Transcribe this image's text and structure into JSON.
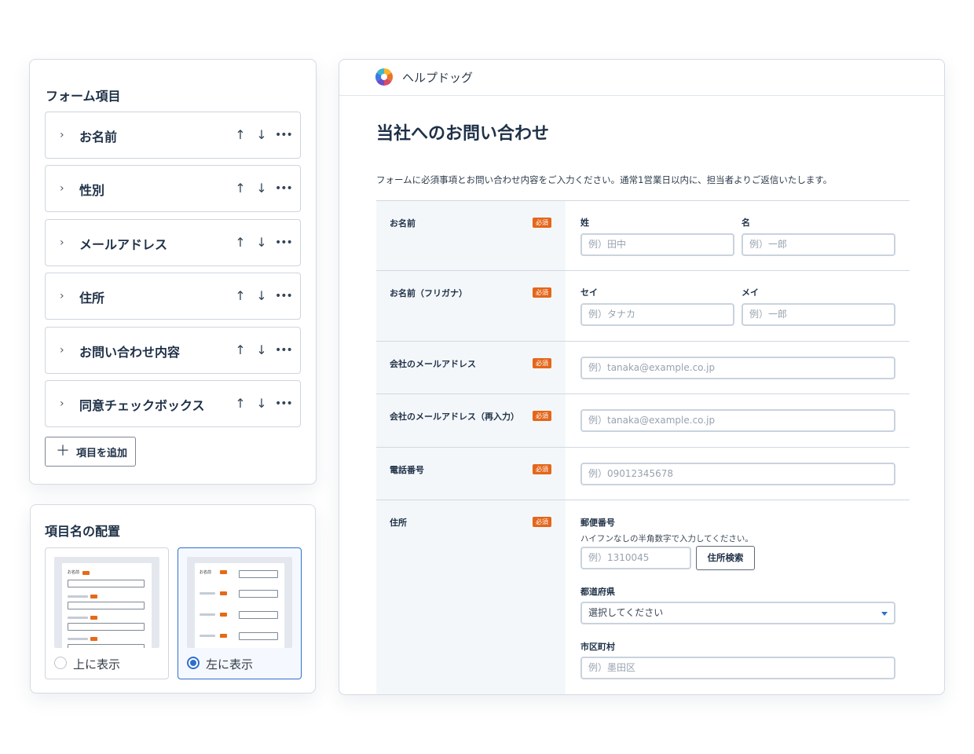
{
  "fields_panel": {
    "title": "フォーム項目",
    "items": [
      {
        "label": "お名前"
      },
      {
        "label": "性別"
      },
      {
        "label": "メールアドレス"
      },
      {
        "label": "住所"
      },
      {
        "label": "お問い合わせ内容"
      },
      {
        "label": "同意チェックボックス"
      }
    ],
    "add_button_label": "項目を追加",
    "icons": {
      "expand": "chevron-right-icon",
      "up": "arrow-up-icon",
      "down": "arrow-down-icon",
      "more": "more-horizontal-icon",
      "add": "plus-icon"
    }
  },
  "placement_panel": {
    "title": "項目名の配置",
    "options": [
      {
        "label": "上に表示",
        "selected": false
      },
      {
        "label": "左に表示",
        "selected": true
      }
    ],
    "thumb_label": "お名前"
  },
  "form": {
    "app_name": "ヘルプドッグ",
    "title": "当社へのお問い合わせ",
    "description": "フォームに必須事項とお問い合わせ内容をご入力ください。通常1営業日以内に、担当者よりご返信いたします。",
    "required_badge": "必須",
    "rows": {
      "name": {
        "label": "お名前",
        "last_label": "姓",
        "last_placeholder": "例）田中",
        "first_label": "名",
        "first_placeholder": "例）一郎"
      },
      "kana": {
        "label": "お名前（フリガナ）",
        "last_label": "セイ",
        "last_placeholder": "例）タナカ",
        "first_label": "メイ",
        "first_placeholder": "例）一郎"
      },
      "email": {
        "label": "会社のメールアドレス",
        "placeholder": "例）tanaka@example.co.jp"
      },
      "email_confirm": {
        "label": "会社のメールアドレス（再入力）",
        "placeholder": "例）tanaka@example.co.jp"
      },
      "phone": {
        "label": "電話番号",
        "placeholder": "例）09012345678"
      },
      "address": {
        "label": "住所",
        "zip_label": "郵便番号",
        "zip_hint": "ハイフンなしの半角数字で入力してください。",
        "zip_placeholder": "例）1310045",
        "zip_search_label": "住所検索",
        "prefecture_label": "都道府県",
        "prefecture_value": "選択してください",
        "city_label": "市区町村",
        "city_placeholder": "例）墨田区"
      }
    }
  },
  "colors": {
    "accent": "#2f6fcc",
    "required": "#e4661b",
    "text": "#1f3147"
  }
}
